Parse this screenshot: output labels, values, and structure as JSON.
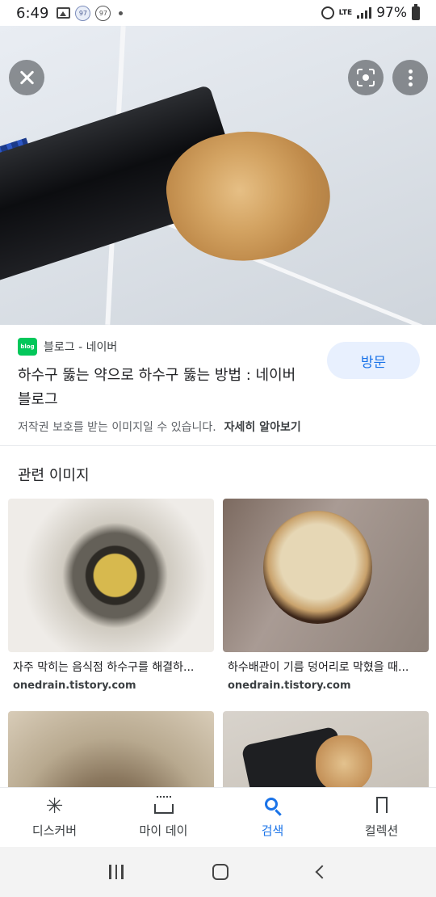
{
  "status_bar": {
    "time": "6:49",
    "notif_1": "97",
    "notif_2": "97",
    "lte": "LTE",
    "battery": "97%"
  },
  "hero": {
    "close_icon": "close-icon",
    "lens_icon": "google-lens-icon",
    "more_icon": "more-vert-icon"
  },
  "result": {
    "source": "블로그 - 네이버",
    "title": "하수구 뚫는 약으로 하수구 뚫는 방법 : 네이버 블로그",
    "visit_label": "방문",
    "copyright": "저작권 보호를 받는 이미지일 수 있습니다.",
    "learn_more": "자세히 알아보기"
  },
  "related": {
    "heading": "관련 이미지",
    "items": [
      {
        "caption": "자주 막히는 음식점 하수구를 해결하...",
        "domain": "onedrain.tistory.com"
      },
      {
        "caption": "하수배관이 기름 덩어리로 막혔을 때...",
        "domain": "onedrain.tistory.com"
      },
      {
        "caption": "",
        "domain": ""
      },
      {
        "caption": "",
        "domain": ""
      }
    ]
  },
  "bottom_nav": {
    "items": [
      {
        "label": "디스커버",
        "icon": "asterisk-icon"
      },
      {
        "label": "마이 데이",
        "icon": "my-day-icon"
      },
      {
        "label": "검색",
        "icon": "search-icon"
      },
      {
        "label": "컬렉션",
        "icon": "collections-icon"
      }
    ]
  },
  "colors": {
    "accent": "#1a73e8",
    "visit_bg": "#e8f0fe",
    "naver_green": "#03c75a"
  }
}
